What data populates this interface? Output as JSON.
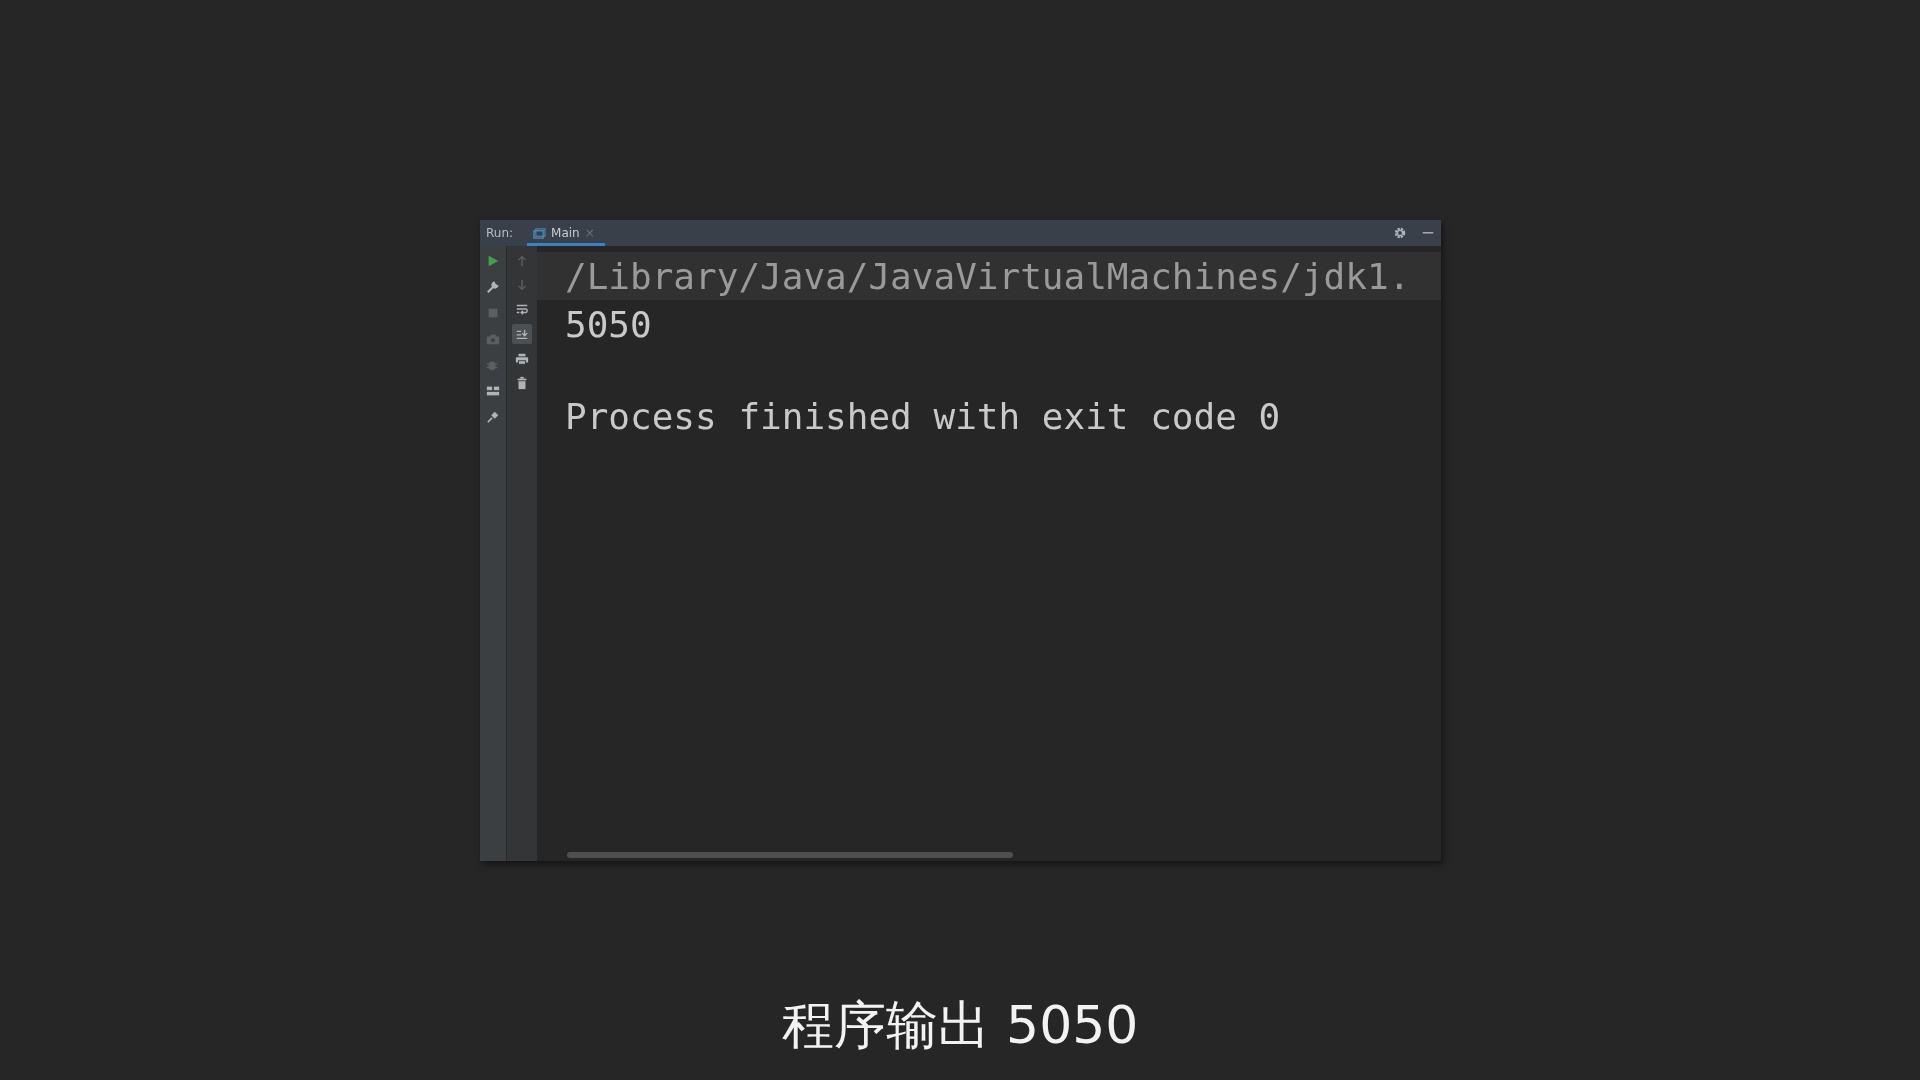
{
  "run_panel": {
    "label": "Run:",
    "tabs": [
      {
        "label": "Main",
        "selected": true,
        "close": "×"
      }
    ],
    "left_tools": [
      {
        "disabled": false
      },
      {
        "disabled": false
      },
      {
        "disabled": true
      },
      {
        "disabled": true
      },
      {
        "disabled": true
      },
      {
        "disabled": false
      },
      {
        "disabled": false
      }
    ],
    "console_tools": [
      {
        "disabled": true,
        "on": false
      },
      {
        "disabled": true,
        "on": false
      },
      {
        "disabled": false,
        "on": false
      },
      {
        "disabled": false,
        "on": true
      },
      {
        "disabled": false,
        "on": false
      },
      {
        "disabled": false,
        "on": false
      }
    ],
    "console_lines": [
      {
        "text": "/Library/Java/JavaVirtualMachines/jdk1.",
        "selected": true
      },
      {
        "text": "5050",
        "selected": false
      },
      {
        "text": "Process finished with exit code 0",
        "selected": false
      }
    ]
  },
  "subtitle": "程序输出 5050"
}
